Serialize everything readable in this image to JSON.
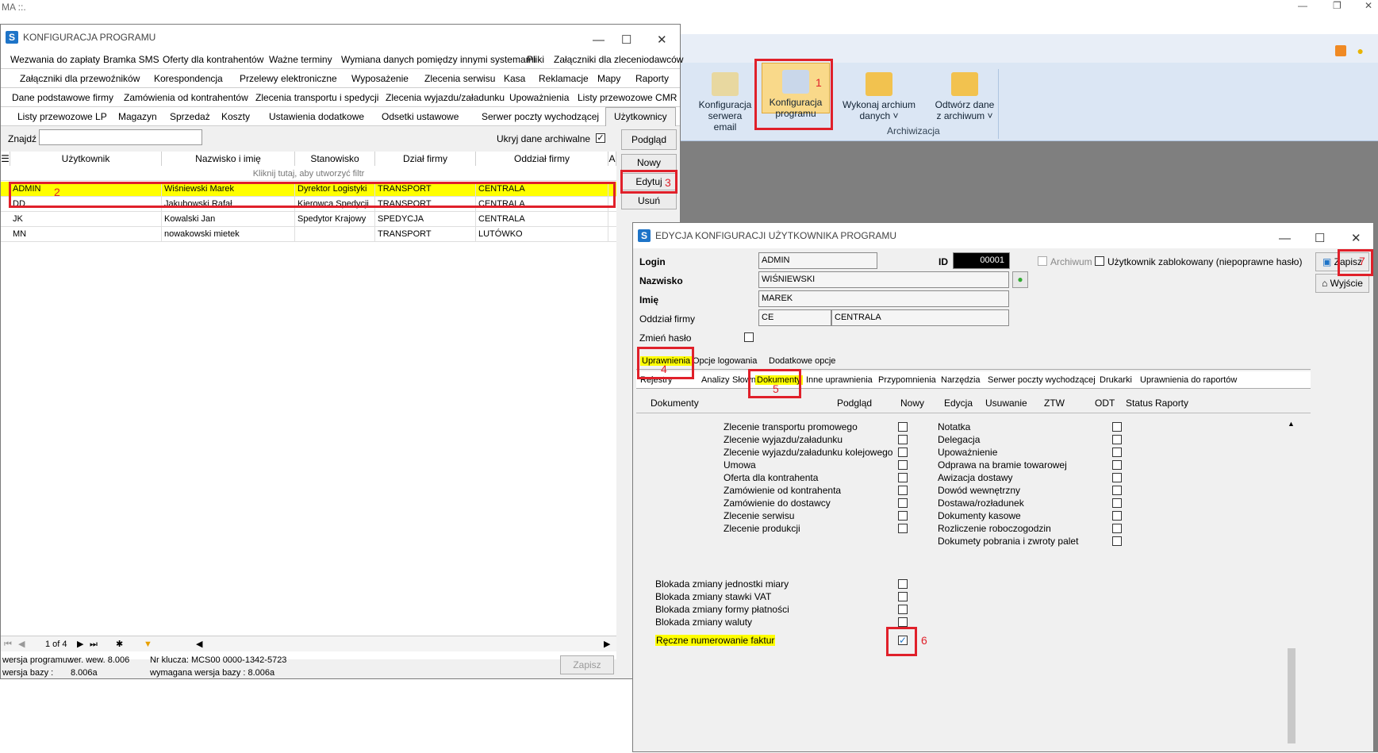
{
  "app": {
    "title": "MA ::."
  },
  "ribbon": {
    "buttons": [
      {
        "label1": "Konfiguracja",
        "label2": "serwera email"
      },
      {
        "label1": "Konfiguracja",
        "label2": "programu"
      },
      {
        "label1": "Wykonaj archium",
        "label2": "danych ˅"
      },
      {
        "label1": "Odtwórz dane",
        "label2": "z archiwum ˅"
      }
    ],
    "group_label": "Archiwizacja"
  },
  "marks": {
    "m1": "1",
    "m2": "2",
    "m3": "3",
    "m4": "4",
    "m5": "5",
    "m6": "6",
    "m7": "7"
  },
  "konfig": {
    "title": "KONFIGURACJA PROGRAMU",
    "tabs_row1": [
      "Wezwania do zapłaty",
      "Bramka SMS",
      "Oferty dla kontrahentów",
      "Ważne terminy",
      "Wymiana danych pomiędzy innymi systemami",
      "Pliki",
      "Załączniki dla zleceniodawców"
    ],
    "tabs_row2": [
      "Załączniki dla przewoźników",
      "Korespondencja",
      "Przelewy elektroniczne",
      "Wyposażenie",
      "Zlecenia serwisu",
      "Kasa",
      "Reklamacje",
      "Mapy",
      "Raporty"
    ],
    "tabs_row3": [
      "Dane podstawowe firmy",
      "Zamówienia od kontrahentów",
      "Zlecenia transportu i spedycji",
      "Zlecenia wyjazdu/załadunku",
      "Upoważnienia",
      "Listy przewozowe CMR"
    ],
    "tabs_row4": [
      "Listy przewozowe LP",
      "Magazyn",
      "Sprzedaż",
      "Koszty",
      "Ustawienia dodatkowe",
      "Odsetki ustawowe",
      "Serwer poczty wychodzącej",
      "Użytkownicy"
    ],
    "find_label": "Znajdź",
    "archive_label": "Ukryj dane archiwalne",
    "buttons": {
      "preview": "Podgląd",
      "new": "Nowy",
      "edit": "Edytuj",
      "delete": "Usuń"
    },
    "columns": [
      "Użytkownik",
      "Nazwisko i imię",
      "Stanowisko",
      "Dział firmy",
      "Oddział firmy",
      "A"
    ],
    "filter_hint": "Kliknij tutaj, aby utworzyć filtr",
    "rows": [
      [
        "ADMIN",
        "Wiśniewski Marek",
        "Dyrektor Logistyki",
        "TRANSPORT",
        "CENTRALA"
      ],
      [
        "DD",
        "Jakubowski Rafał",
        "Kierowca Spedycji",
        "TRANSPORT",
        "CENTRALA"
      ],
      [
        "JK",
        "Kowalski Jan",
        "Spedytor Krajowy",
        "SPEDYCJA",
        "CENTRALA"
      ],
      [
        "MN",
        "nowakowski mietek",
        "",
        "TRANSPORT",
        "LUTÓWKO"
      ]
    ],
    "pager": "1 of 4",
    "status": {
      "ver_label": "wersja programu :",
      "ver_value": "wer. wew. 8.006",
      "db_label": "wersja bazy :",
      "db_value": "8.006a",
      "key_label": "Nr klucza: MCS00 0000-1342-5723",
      "req_label": "wymagana wersja bazy : 8.006a"
    },
    "save": "Zapisz"
  },
  "edit": {
    "title": "EDYCJA KONFIGURACJI UŻYTKOWNIKA PROGRAMU",
    "labels": {
      "login": "Login",
      "surname": "Nazwisko",
      "name": "Imię",
      "branch": "Oddział firmy",
      "change_pw": "Zmień hasło",
      "id": "ID",
      "archive": "Archiwum",
      "blocked": "Użytkownik zablokowany (niepoprawne hasło)"
    },
    "values": {
      "login": "ADMIN",
      "id": "00001",
      "surname": "WIŚNIEWSKI",
      "name": "MAREK",
      "branch_code": "CE",
      "branch_name": "CENTRALA"
    },
    "save": "Zapisz",
    "exit": "Wyjście",
    "tabs1": [
      "Uprawnienia",
      "Opcje logowania",
      "Dodatkowe opcje"
    ],
    "tabs2": [
      "Rejestry",
      "Analizy",
      "Słowniki",
      "Dokumenty",
      "Inne uprawnienia",
      "Przypomnienia",
      "Narzędzia",
      "Serwer poczty wychodzącej",
      "Drukarki",
      "Uprawnienia do raportów"
    ],
    "cols": [
      "Dokumenty",
      "Podgląd",
      "Nowy",
      "Edycja",
      "Usuwanie",
      "ZTW",
      "ODT",
      "Status",
      "Raporty"
    ],
    "left_docs": [
      "Zlecenie transportu promowego",
      "Zlecenie wyjazdu/załadunku",
      "Zlecenie wyjazdu/załadunku kolejowego",
      "Umowa",
      "Oferta dla kontrahenta",
      "Zamówienie od kontrahenta",
      "Zamówienie do dostawcy",
      "Zlecenie serwisu",
      "Zlecenie produkcji"
    ],
    "right_docs": [
      "Notatka",
      "Delegacja",
      "Upoważnienie",
      "Odprawa na bramie towarowej",
      "Awizacja dostawy",
      "Dowód wewnętrzny",
      "Dostawa/rozładunek",
      "Dokumenty kasowe",
      "Rozliczenie roboczogodzin",
      "Dokumety pobrania i zwroty palet"
    ],
    "blocks": [
      "Blokada zmiany jednostki miary",
      "Blokada zmiany stawki VAT",
      "Blokada zmiany formy płatności",
      "Blokada zmiany waluty"
    ],
    "manual": "Ręczne numerowanie faktur"
  },
  "colors": {
    "highlight": "#ffff00",
    "mark": "#e0202a",
    "accent": "#1e74c8"
  }
}
